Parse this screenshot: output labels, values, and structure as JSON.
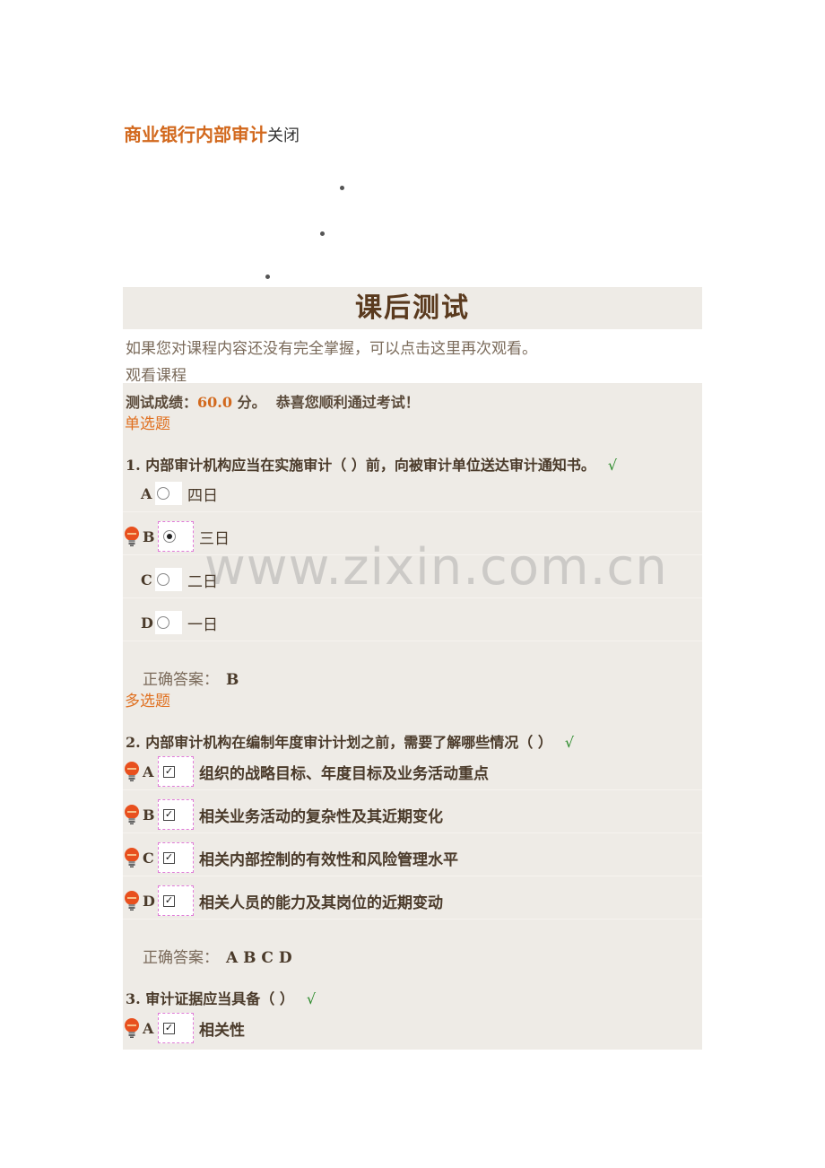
{
  "header": {
    "course_title": "商业银行内部审计",
    "close_label": "关闭"
  },
  "page_title": "课后测试",
  "intro_text": "如果您对课程内容还没有完全掌握，可以点击这里再次观看。",
  "watch_link": "观看课程",
  "score": {
    "label": "测试成绩：",
    "value": "60.0",
    "unit": "分。",
    "message": "恭喜您顺利通过考试！"
  },
  "sections": {
    "single": "单选题",
    "multi": "多选题"
  },
  "answer_label": "正确答案：",
  "check_mark": "√",
  "questions": [
    {
      "text": "1. 内部审计机构应当在实施审计（ ）前，向被审计单位送达审计通知书。",
      "options": [
        {
          "letter": "A",
          "text": "四日"
        },
        {
          "letter": "B",
          "text": "三日"
        },
        {
          "letter": "C",
          "text": "二日"
        },
        {
          "letter": "D",
          "text": "一日"
        }
      ],
      "answer": "B"
    },
    {
      "text": "2. 内部审计机构在编制年度审计计划之前，需要了解哪些情况（ ）",
      "options": [
        {
          "letter": "A",
          "text": "组织的战略目标、年度目标及业务活动重点"
        },
        {
          "letter": "B",
          "text": "相关业务活动的复杂性及其近期变化"
        },
        {
          "letter": "C",
          "text": "相关内部控制的有效性和风险管理水平"
        },
        {
          "letter": "D",
          "text": "相关人员的能力及其岗位的近期变动"
        }
      ],
      "answer": "A B C D"
    },
    {
      "text": "3. 审计证据应当具备（ ）",
      "options": [
        {
          "letter": "A",
          "text": "相关性"
        }
      ]
    }
  ],
  "watermark": "www.zixin.com.cn",
  "colors": {
    "accent": "#d2691e",
    "panel": "#eeebe6",
    "check": "#2a8a2a",
    "selection_border": "#e07ad8"
  }
}
